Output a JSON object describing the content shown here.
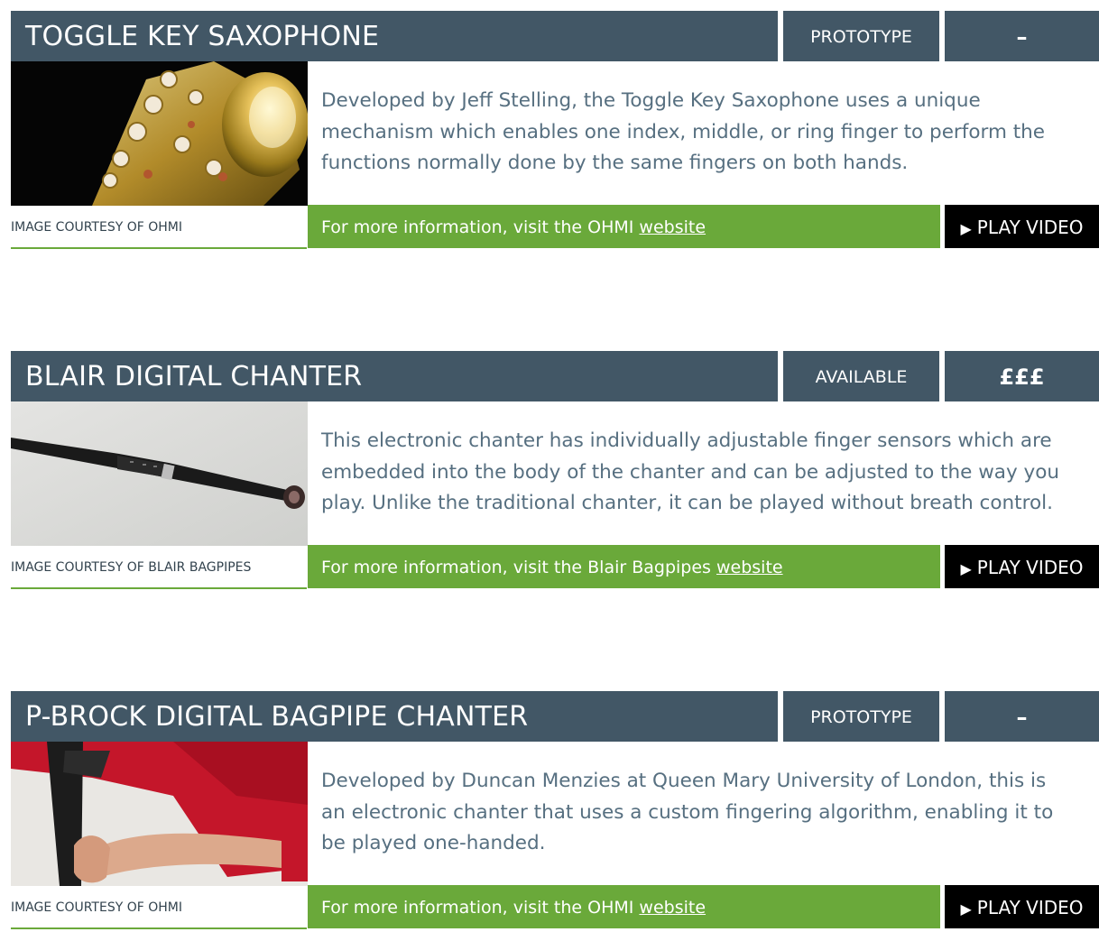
{
  "items": [
    {
      "title": "TOGGLE KEY SAXOPHONE",
      "status": "PROTOTYPE",
      "price": "–",
      "description_lines": [
        "Developed by Jeff Stelling, the Toggle Key Saxophone uses a unique",
        "mechanism which enables one index, middle, or ring finger to perform the",
        "functions normally done by the same fingers on both hands."
      ],
      "credit": "IMAGE COURTESY OF OHMI",
      "info_prefix": "For more information, visit the OHMI ",
      "info_link": "website",
      "video_label": "PLAY VIDEO",
      "image_subject": "saxophone-photo"
    },
    {
      "title": "BLAIR DIGITAL CHANTER",
      "status": "AVAILABLE",
      "price": "£££",
      "description_lines": [
        "This electronic chanter has individually adjustable finger sensors which are",
        "embedded into the body of the chanter and can be adjusted to the way you",
        "play. Unlike the traditional chanter, it can be played without breath control."
      ],
      "credit": "IMAGE COURTESY OF BLAIR BAGPIPES",
      "info_prefix": "For more information, visit the Blair Bagpipes ",
      "info_link": "website",
      "video_label": "PLAY VIDEO",
      "image_subject": "chanter-photo"
    },
    {
      "title": "P-BROCK DIGITAL BAGPIPE CHANTER",
      "status": "PROTOTYPE",
      "price": "–",
      "description_lines": [
        "Developed by Duncan Menzies at Queen Mary University of London, this is",
        "an electronic chanter that uses a custom fingering algorithm, enabling it to",
        "be played one-handed."
      ],
      "credit": "IMAGE COURTESY OF OHMI",
      "info_prefix": "For more information, visit the OHMI ",
      "info_link": "website",
      "video_label": "PLAY VIDEO",
      "image_subject": "bagpipe-player-photo"
    }
  ],
  "colors": {
    "header_bg": "#425766",
    "info_bar_bg": "#6aa93a",
    "video_bg": "#000000",
    "description_text": "#566f80"
  }
}
